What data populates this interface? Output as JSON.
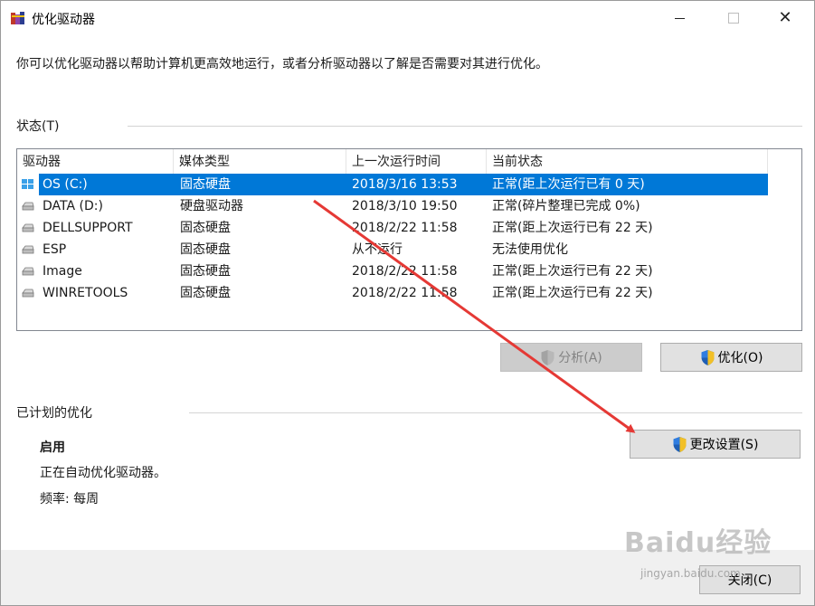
{
  "window": {
    "title": "优化驱动器",
    "controls": {
      "minimize_icon": "minimize-icon",
      "maximize_icon": "maximize-icon",
      "close_icon": "close-icon",
      "close_glyph": "✕"
    }
  },
  "description": "你可以优化驱动器以帮助计算机更高效地运行，或者分析驱动器以了解是否需要对其进行优化。",
  "status_section": {
    "label": "状态(T)",
    "columns": [
      "驱动器",
      "媒体类型",
      "上一次运行时间",
      "当前状态"
    ],
    "rows": [
      {
        "drive": "OS (C:)",
        "media": "固态硬盘",
        "last_run": "2018/3/16 13:53",
        "status": "正常(距上次运行已有 0 天)",
        "selected": true,
        "icon": "windows-drive-icon"
      },
      {
        "drive": "DATA (D:)",
        "media": "硬盘驱动器",
        "last_run": "2018/3/10 19:50",
        "status": "正常(碎片整理已完成 0%)",
        "selected": false,
        "icon": "drive-icon"
      },
      {
        "drive": "DELLSUPPORT",
        "media": "固态硬盘",
        "last_run": "2018/2/22 11:58",
        "status": "正常(距上次运行已有 22 天)",
        "selected": false,
        "icon": "drive-icon"
      },
      {
        "drive": "ESP",
        "media": "固态硬盘",
        "last_run": "从不运行",
        "status": "无法使用优化",
        "selected": false,
        "icon": "drive-icon"
      },
      {
        "drive": "Image",
        "media": "固态硬盘",
        "last_run": "2018/2/22 11:58",
        "status": "正常(距上次运行已有 22 天)",
        "selected": false,
        "icon": "drive-icon"
      },
      {
        "drive": "WINRETOOLS",
        "media": "固态硬盘",
        "last_run": "2018/2/22 11:58",
        "status": "正常(距上次运行已有 22 天)",
        "selected": false,
        "icon": "drive-icon"
      }
    ],
    "analyze_button": "分析(A)",
    "optimize_button": "优化(O)"
  },
  "scheduled_section": {
    "label": "已计划的优化",
    "state": "启用",
    "info": "正在自动优化驱动器。",
    "frequency": "频率: 每周",
    "change_settings_button": "更改设置(S)"
  },
  "close_button": "关闭(C)",
  "watermark": {
    "brand": "Baidu经验",
    "url": "jingyan.baidu.com"
  },
  "colors": {
    "selection": "#0078d7",
    "arrow": "#e53935"
  }
}
